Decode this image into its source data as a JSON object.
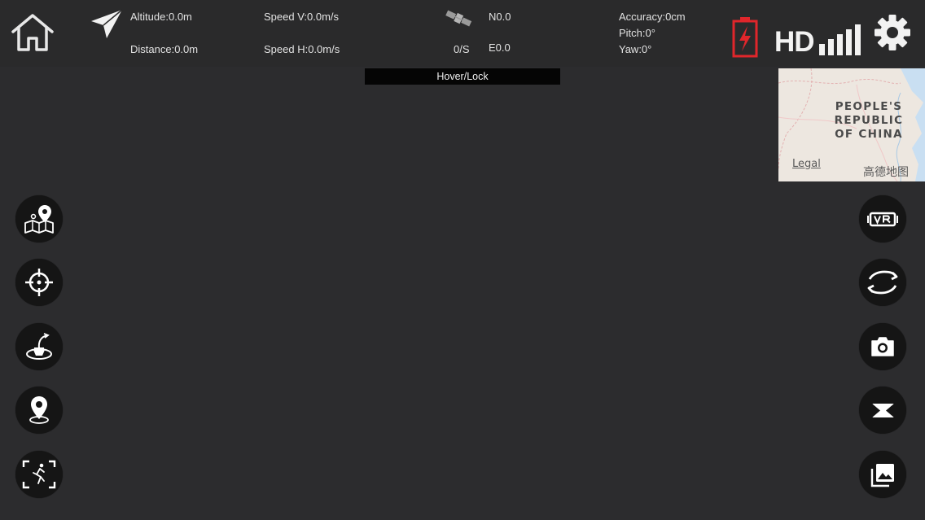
{
  "telemetry": {
    "altitude": "Altitude:0.0m",
    "distance": "Distance:0.0m",
    "speed_v": "Speed V:0.0m/s",
    "speed_h": "Speed H:0.0m/s",
    "satellites": "0/S",
    "north": "N0.0",
    "east": "E0.0",
    "accuracy": "Accuracy:0cm",
    "pitch": "Pitch:0°",
    "yaw": "Yaw:0°"
  },
  "header": {
    "hd_label": "HD",
    "icons": [
      "home-icon",
      "direction-arrow-icon",
      "satellite-icon",
      "battery-charging-icon",
      "signal-bars-icon",
      "gear-icon"
    ]
  },
  "status": {
    "mode": "Hover/Lock"
  },
  "minimap": {
    "country_label": "PEOPLE'S REPUBLIC OF CHINA",
    "legal": "Legal",
    "provider": "高德地图"
  },
  "left_buttons": [
    "map-waypoint-icon",
    "crosshair-target-icon",
    "orbit-drone-icon",
    "location-pin-icon",
    "follow-me-icon"
  ],
  "right_buttons": [
    "vr-icon",
    "switch-camera-icon",
    "camera-icon",
    "video-icon",
    "gallery-icon"
  ],
  "colors": {
    "background": "#2c2c2e",
    "topbar": "#2a2a2b",
    "button": "#151515",
    "battery_alert": "#e0262b",
    "text": "#e2e2e2"
  }
}
